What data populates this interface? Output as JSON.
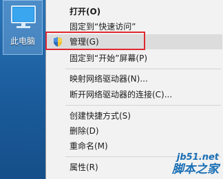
{
  "desktop": {
    "icon_label": "此电脑"
  },
  "context_menu": {
    "items": [
      {
        "label": "打开(O)",
        "bold": true
      },
      {
        "label": "固定到“快速访问”"
      },
      {
        "label": "管理(G)",
        "icon": "uac-shield-icon",
        "highlighted": true
      },
      {
        "label": "固定到“开始”屏幕(P)"
      },
      {
        "label": "映射网络驱动器(N)..."
      },
      {
        "label": "断开网络驱动器的连接(C)..."
      },
      {
        "label": "创建快捷方式(S)"
      },
      {
        "label": "删除(D)"
      },
      {
        "label": "重命名(M)"
      },
      {
        "label": "属性(R)"
      }
    ]
  },
  "watermark": {
    "line1": "jb51.net",
    "line2": "脚本之家"
  },
  "colors": {
    "highlight_box": "#e0262f",
    "menu_background": "#f2f2f2",
    "desktop_background": "#1b5fa0"
  }
}
